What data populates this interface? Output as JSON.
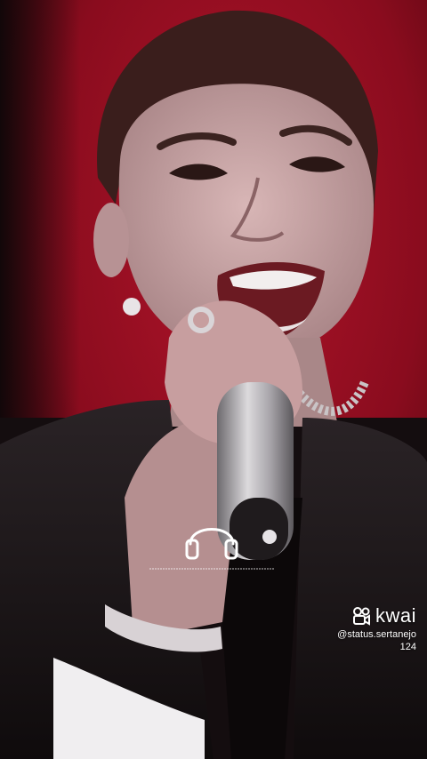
{
  "watermark": {
    "brand": "kwai",
    "handle": "@status.sertanejo",
    "count": "124",
    "logo_icon": "kwai-logo-icon"
  },
  "overlay": {
    "icon": "headphones-icon"
  },
  "colors": {
    "background_red": "#8d0c1c",
    "jacket": "#1a1416",
    "skin": "#c9a7a8"
  }
}
